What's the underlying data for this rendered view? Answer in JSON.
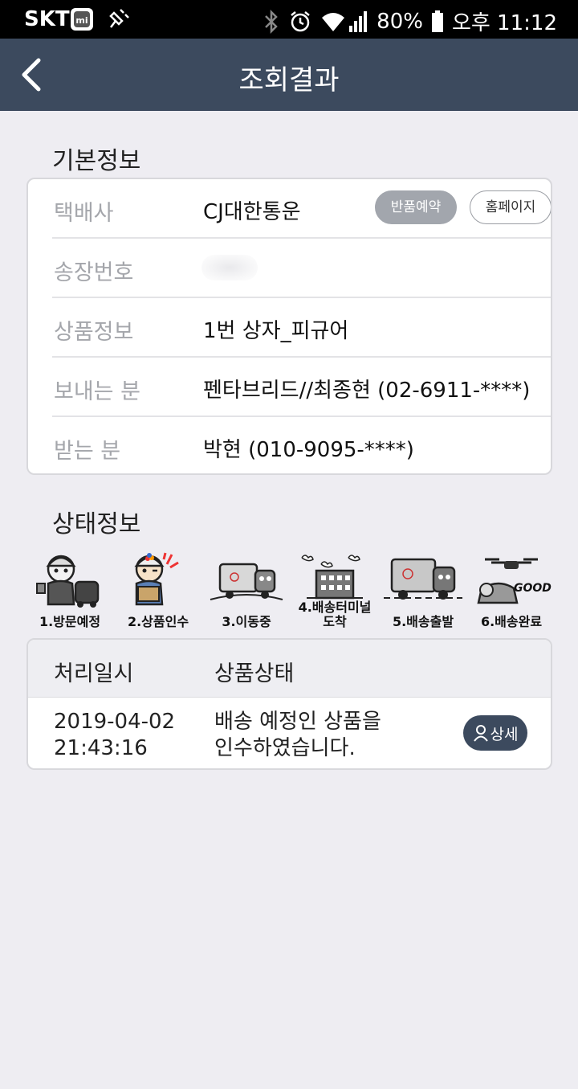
{
  "status_bar": {
    "carrier": "SKT",
    "battery": "80%",
    "time": "오후 11:12"
  },
  "app_bar": {
    "title": "조회결과"
  },
  "basic_info": {
    "section_title": "기본정보",
    "rows": [
      {
        "label": "택배사",
        "value": "CJ대한통운"
      },
      {
        "label": "송장번호",
        "value": ""
      },
      {
        "label": "상품정보",
        "value": "1번 상자_피규어"
      },
      {
        "label": "보내는 분",
        "value": "펜타브리드//최종현 (02-6911-****)"
      },
      {
        "label": "받는 분",
        "value": "박현 (010-9095-****)"
      }
    ],
    "return_button": "반품예약",
    "homepage_button": "홈페이지"
  },
  "status_info": {
    "section_title": "상태정보",
    "steps": [
      {
        "label": "1.방문예정",
        "icon": "courier-visit-icon"
      },
      {
        "label": "2.상품인수",
        "icon": "package-pickup-icon"
      },
      {
        "label": "3.이동중",
        "icon": "truck-moving-icon"
      },
      {
        "label_line1": "4.배송터미널",
        "label_line2": "도착",
        "icon": "terminal-building-icon"
      },
      {
        "label": "5.배송출발",
        "icon": "delivery-truck-icon"
      },
      {
        "label": "6.배송완료",
        "icon": "drone-delivered-icon",
        "badge": "GOOD"
      }
    ]
  },
  "history": {
    "col_datetime": "처리일시",
    "col_status": "상품상태",
    "rows": [
      {
        "date": "2019-04-02",
        "time": "21:43:16",
        "desc_line1": "배송 예정인 상품을",
        "desc_line2": "인수하였습니다.",
        "detail_button": "상세"
      }
    ]
  },
  "colors": {
    "app_bar": "#3c4a5e",
    "background": "#eeedf2",
    "label_gray": "#a4a6ab",
    "return_pill": "#a2a6ad"
  }
}
